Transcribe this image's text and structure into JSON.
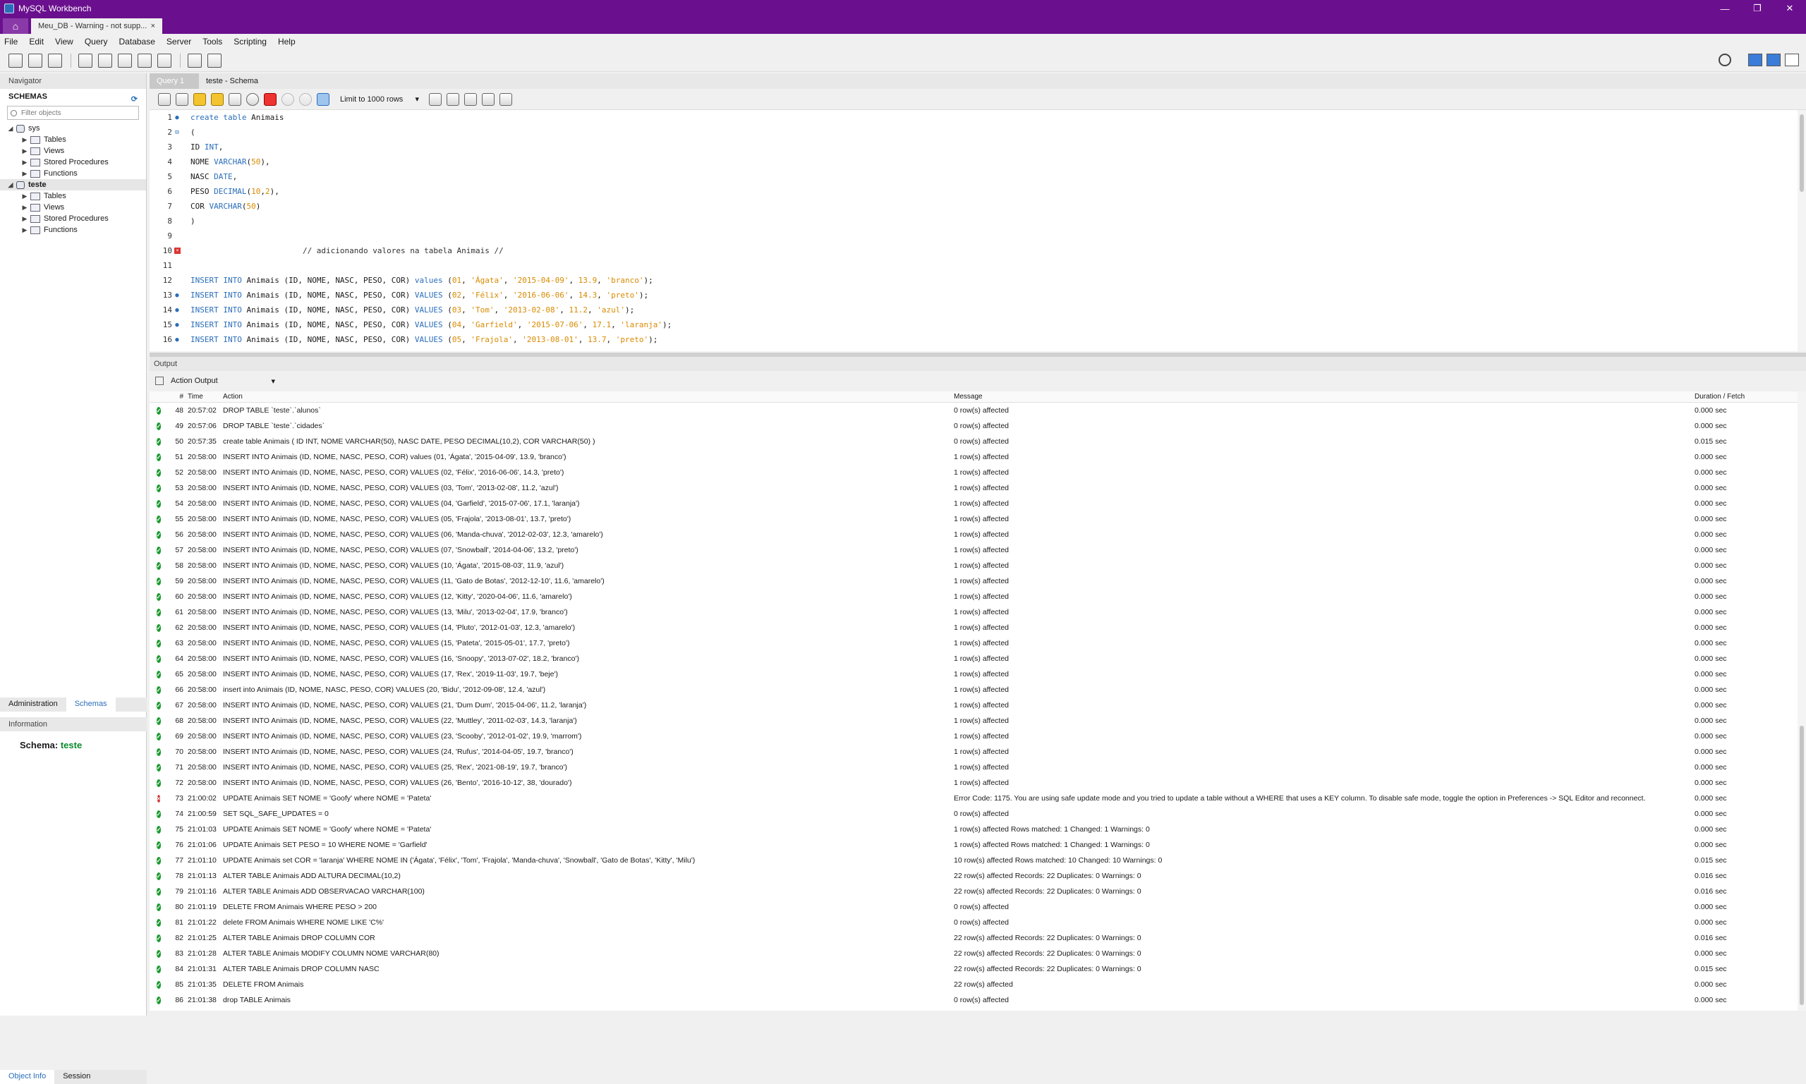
{
  "window": {
    "title": "MySQL Workbench",
    "controls": [
      "—",
      "❐",
      "✕"
    ]
  },
  "connection_tab": {
    "label": "Meu_DB - Warning - not supp...",
    "close": "×"
  },
  "menu": [
    "File",
    "Edit",
    "View",
    "Query",
    "Database",
    "Server",
    "Tools",
    "Scripting",
    "Help"
  ],
  "navigator": {
    "header": "Navigator",
    "schemas_label": "SCHEMAS",
    "filter_placeholder": "Filter objects",
    "tree": [
      {
        "label": "sys",
        "level": 0,
        "type": "db",
        "expanded": true
      },
      {
        "label": "Tables",
        "level": 1,
        "type": "folder"
      },
      {
        "label": "Views",
        "level": 1,
        "type": "folder"
      },
      {
        "label": "Stored Procedures",
        "level": 1,
        "type": "folder"
      },
      {
        "label": "Functions",
        "level": 1,
        "type": "folder"
      },
      {
        "label": "teste",
        "level": 0,
        "type": "db",
        "expanded": true,
        "selected": true
      },
      {
        "label": "Tables",
        "level": 1,
        "type": "folder"
      },
      {
        "label": "Views",
        "level": 1,
        "type": "folder"
      },
      {
        "label": "Stored Procedures",
        "level": 1,
        "type": "folder"
      },
      {
        "label": "Functions",
        "level": 1,
        "type": "folder"
      }
    ],
    "bottom_tabs": [
      "Administration",
      "Schemas"
    ],
    "info_header": "Information",
    "info_label": "Schema:",
    "info_value": "teste",
    "object_tabs": [
      "Object Info",
      "Session"
    ]
  },
  "editor": {
    "tabs": [
      "Query 1",
      "teste - Schema"
    ],
    "limit": "Limit to 1000 rows",
    "lines": [
      {
        "n": "1",
        "mark": "dot",
        "code": [
          [
            "create table ",
            "kw"
          ],
          [
            "Animais",
            ""
          ]
        ]
      },
      {
        "n": "2",
        "mark": "fold",
        "code": [
          [
            "(",
            ""
          ]
        ]
      },
      {
        "n": "3",
        "mark": "",
        "code": [
          [
            "ID ",
            ""
          ],
          [
            "INT",
            "kw"
          ],
          [
            ",",
            ""
          ]
        ]
      },
      {
        "n": "4",
        "mark": "",
        "code": [
          [
            "NOME ",
            ""
          ],
          [
            "VARCHAR",
            "kw"
          ],
          [
            "(",
            ""
          ],
          [
            "50",
            "num"
          ],
          [
            "),",
            ""
          ]
        ]
      },
      {
        "n": "5",
        "mark": "",
        "code": [
          [
            "NASC ",
            ""
          ],
          [
            "DATE",
            "kw"
          ],
          [
            ",",
            ""
          ]
        ]
      },
      {
        "n": "6",
        "mark": "",
        "code": [
          [
            "PESO ",
            ""
          ],
          [
            "DECIMAL",
            "kw"
          ],
          [
            "(",
            ""
          ],
          [
            "10",
            "num"
          ],
          [
            ",",
            ""
          ],
          [
            "2",
            "num"
          ],
          [
            "),",
            ""
          ]
        ]
      },
      {
        "n": "7",
        "mark": "",
        "code": [
          [
            "COR ",
            ""
          ],
          [
            "VARCHAR",
            "kw"
          ],
          [
            "(",
            ""
          ],
          [
            "50",
            "num"
          ],
          [
            ")",
            ""
          ]
        ]
      },
      {
        "n": "8",
        "mark": "",
        "code": [
          [
            ")",
            ""
          ]
        ]
      },
      {
        "n": "9",
        "mark": "",
        "code": [
          [
            "",
            ""
          ]
        ]
      },
      {
        "n": "10",
        "mark": "err",
        "code": [
          [
            "                        // adicionando valores na tabela Animais //",
            "cmt"
          ]
        ]
      },
      {
        "n": "11",
        "mark": "",
        "code": [
          [
            "",
            ""
          ]
        ]
      },
      {
        "n": "12",
        "mark": "",
        "code": [
          [
            "INSERT INTO ",
            "kw"
          ],
          [
            "Animais (ID, NOME, NASC, PESO, COR) ",
            ""
          ],
          [
            "values",
            "kw"
          ],
          [
            " (",
            ""
          ],
          [
            "01",
            "num"
          ],
          [
            ", ",
            ""
          ],
          [
            "'Ágata'",
            "str"
          ],
          [
            ", ",
            ""
          ],
          [
            "'2015-04-09'",
            "str"
          ],
          [
            ", ",
            ""
          ],
          [
            "13.9",
            "num"
          ],
          [
            ", ",
            ""
          ],
          [
            "'branco'",
            "str"
          ],
          [
            ");",
            ""
          ]
        ]
      },
      {
        "n": "13",
        "mark": "dot",
        "code": [
          [
            "INSERT INTO ",
            "kw"
          ],
          [
            "Animais (ID, NOME, NASC, PESO, COR) ",
            ""
          ],
          [
            "VALUES",
            "kw"
          ],
          [
            " (",
            ""
          ],
          [
            "02",
            "num"
          ],
          [
            ", ",
            ""
          ],
          [
            "'Félix'",
            "str"
          ],
          [
            ", ",
            ""
          ],
          [
            "'2016-06-06'",
            "str"
          ],
          [
            ", ",
            ""
          ],
          [
            "14.3",
            "num"
          ],
          [
            ", ",
            ""
          ],
          [
            "'preto'",
            "str"
          ],
          [
            ");",
            ""
          ]
        ]
      },
      {
        "n": "14",
        "mark": "dot",
        "code": [
          [
            "INSERT INTO ",
            "kw"
          ],
          [
            "Animais (ID, NOME, NASC, PESO, COR) ",
            ""
          ],
          [
            "VALUES",
            "kw"
          ],
          [
            " (",
            ""
          ],
          [
            "03",
            "num"
          ],
          [
            ", ",
            ""
          ],
          [
            "'Tom'",
            "str"
          ],
          [
            ", ",
            ""
          ],
          [
            "'2013-02-08'",
            "str"
          ],
          [
            ", ",
            ""
          ],
          [
            "11.2",
            "num"
          ],
          [
            ", ",
            ""
          ],
          [
            "'azul'",
            "str"
          ],
          [
            ");",
            ""
          ]
        ]
      },
      {
        "n": "15",
        "mark": "dot",
        "code": [
          [
            "INSERT INTO ",
            "kw"
          ],
          [
            "Animais (ID, NOME, NASC, PESO, COR) ",
            ""
          ],
          [
            "VALUES",
            "kw"
          ],
          [
            " (",
            ""
          ],
          [
            "04",
            "num"
          ],
          [
            ", ",
            ""
          ],
          [
            "'Garfield'",
            "str"
          ],
          [
            ", ",
            ""
          ],
          [
            "'2015-07-06'",
            "str"
          ],
          [
            ", ",
            ""
          ],
          [
            "17.1",
            "num"
          ],
          [
            ", ",
            ""
          ],
          [
            "'laranja'",
            "str"
          ],
          [
            ");",
            ""
          ]
        ]
      },
      {
        "n": "16",
        "mark": "dot",
        "code": [
          [
            "INSERT INTO ",
            "kw"
          ],
          [
            "Animais (ID, NOME, NASC, PESO, COR) ",
            ""
          ],
          [
            "VALUES",
            "kw"
          ],
          [
            " (",
            ""
          ],
          [
            "05",
            "num"
          ],
          [
            ", ",
            ""
          ],
          [
            "'Frajola'",
            "str"
          ],
          [
            ", ",
            ""
          ],
          [
            "'2013-08-01'",
            "str"
          ],
          [
            ", ",
            ""
          ],
          [
            "13.7",
            "num"
          ],
          [
            ", ",
            ""
          ],
          [
            "'preto'",
            "str"
          ],
          [
            ");",
            ""
          ]
        ]
      }
    ]
  },
  "output": {
    "header": "Output",
    "selector": "Action Output",
    "columns": [
      "#",
      "Time",
      "Action",
      "Message",
      "Duration / Fetch"
    ],
    "rows": [
      {
        "s": "ok",
        "n": "48",
        "t": "20:57:02",
        "a": "DROP TABLE `teste`.`alunos`",
        "m": "0 row(s) affected",
        "d": "0.000 sec"
      },
      {
        "s": "ok",
        "n": "49",
        "t": "20:57:06",
        "a": "DROP TABLE `teste`.`cidades`",
        "m": "0 row(s) affected",
        "d": "0.000 sec"
      },
      {
        "s": "ok",
        "n": "50",
        "t": "20:57:35",
        "a": "create table Animais ( ID INT, NOME VARCHAR(50), NASC DATE, PESO DECIMAL(10,2), COR VARCHAR(50) )",
        "m": "0 row(s) affected",
        "d": "0.015 sec"
      },
      {
        "s": "ok",
        "n": "51",
        "t": "20:58:00",
        "a": "INSERT INTO Animais (ID, NOME, NASC, PESO, COR) values (01, 'Ágata', '2015-04-09', 13.9, 'branco')",
        "m": "1 row(s) affected",
        "d": "0.000 sec"
      },
      {
        "s": "ok",
        "n": "52",
        "t": "20:58:00",
        "a": "INSERT INTO Animais (ID, NOME, NASC, PESO, COR) VALUES (02, 'Félix', '2016-06-06', 14.3, 'preto')",
        "m": "1 row(s) affected",
        "d": "0.000 sec"
      },
      {
        "s": "ok",
        "n": "53",
        "t": "20:58:00",
        "a": "INSERT INTO Animais (ID, NOME, NASC, PESO, COR) VALUES (03, 'Tom', '2013-02-08', 11.2, 'azul')",
        "m": "1 row(s) affected",
        "d": "0.000 sec"
      },
      {
        "s": "ok",
        "n": "54",
        "t": "20:58:00",
        "a": "INSERT INTO Animais (ID, NOME, NASC, PESO, COR) VALUES (04, 'Garfield', '2015-07-06', 17.1, 'laranja')",
        "m": "1 row(s) affected",
        "d": "0.000 sec"
      },
      {
        "s": "ok",
        "n": "55",
        "t": "20:58:00",
        "a": "INSERT INTO Animais (ID, NOME, NASC, PESO, COR) VALUES (05, 'Frajola', '2013-08-01', 13.7, 'preto')",
        "m": "1 row(s) affected",
        "d": "0.000 sec"
      },
      {
        "s": "ok",
        "n": "56",
        "t": "20:58:00",
        "a": "INSERT INTO Animais (ID, NOME, NASC, PESO, COR) VALUES (06, 'Manda-chuva', '2012-02-03', 12.3, 'amarelo')",
        "m": "1 row(s) affected",
        "d": "0.000 sec"
      },
      {
        "s": "ok",
        "n": "57",
        "t": "20:58:00",
        "a": "INSERT INTO Animais (ID, NOME, NASC, PESO, COR) VALUES (07, 'Snowball', '2014-04-06', 13.2, 'preto')",
        "m": "1 row(s) affected",
        "d": "0.000 sec"
      },
      {
        "s": "ok",
        "n": "58",
        "t": "20:58:00",
        "a": "INSERT INTO Animais (ID, NOME, NASC, PESO, COR) VALUES (10, 'Ágata', '2015-08-03', 11.9, 'azul')",
        "m": "1 row(s) affected",
        "d": "0.000 sec"
      },
      {
        "s": "ok",
        "n": "59",
        "t": "20:58:00",
        "a": "INSERT INTO Animais (ID, NOME, NASC, PESO, COR) VALUES (11, 'Gato de Botas', '2012-12-10', 11.6, 'amarelo')",
        "m": "1 row(s) affected",
        "d": "0.000 sec"
      },
      {
        "s": "ok",
        "n": "60",
        "t": "20:58:00",
        "a": "INSERT INTO Animais (ID, NOME, NASC, PESO, COR) VALUES (12, 'Kitty', '2020-04-06', 11.6, 'amarelo')",
        "m": "1 row(s) affected",
        "d": "0.000 sec"
      },
      {
        "s": "ok",
        "n": "61",
        "t": "20:58:00",
        "a": "INSERT INTO Animais (ID, NOME, NASC, PESO, COR) VALUES (13, 'Milu', '2013-02-04', 17.9, 'branco')",
        "m": "1 row(s) affected",
        "d": "0.000 sec"
      },
      {
        "s": "ok",
        "n": "62",
        "t": "20:58:00",
        "a": "INSERT INTO Animais (ID, NOME, NASC, PESO, COR) VALUES (14, 'Pluto', '2012-01-03', 12.3, 'amarelo')",
        "m": "1 row(s) affected",
        "d": "0.000 sec"
      },
      {
        "s": "ok",
        "n": "63",
        "t": "20:58:00",
        "a": "INSERT INTO Animais (ID, NOME, NASC, PESO, COR) VALUES (15, 'Pateta', '2015-05-01', 17.7, 'preto')",
        "m": "1 row(s) affected",
        "d": "0.000 sec"
      },
      {
        "s": "ok",
        "n": "64",
        "t": "20:58:00",
        "a": "INSERT INTO Animais (ID, NOME, NASC, PESO, COR) VALUES (16, 'Snoopy', '2013-07-02', 18.2, 'branco')",
        "m": "1 row(s) affected",
        "d": "0.000 sec"
      },
      {
        "s": "ok",
        "n": "65",
        "t": "20:58:00",
        "a": "INSERT INTO Animais (ID, NOME, NASC, PESO, COR) VALUES (17, 'Rex', '2019-11-03', 19.7, 'beje')",
        "m": "1 row(s) affected",
        "d": "0.000 sec"
      },
      {
        "s": "ok",
        "n": "66",
        "t": "20:58:00",
        "a": "insert into Animais (ID, NOME, NASC, PESO, COR) VALUES (20, 'Bidu', '2012-09-08', 12.4, 'azul')",
        "m": "1 row(s) affected",
        "d": "0.000 sec"
      },
      {
        "s": "ok",
        "n": "67",
        "t": "20:58:00",
        "a": "INSERT INTO Animais (ID, NOME, NASC, PESO, COR) VALUES (21, 'Dum Dum', '2015-04-06', 11.2, 'laranja')",
        "m": "1 row(s) affected",
        "d": "0.000 sec"
      },
      {
        "s": "ok",
        "n": "68",
        "t": "20:58:00",
        "a": "INSERT INTO Animais (ID, NOME, NASC, PESO, COR) VALUES (22, 'Muttley', '2011-02-03', 14.3, 'laranja')",
        "m": "1 row(s) affected",
        "d": "0.000 sec"
      },
      {
        "s": "ok",
        "n": "69",
        "t": "20:58:00",
        "a": "INSERT INTO Animais (ID, NOME, NASC, PESO, COR) VALUES (23, 'Scooby', '2012-01-02', 19.9, 'marrom')",
        "m": "1 row(s) affected",
        "d": "0.000 sec"
      },
      {
        "s": "ok",
        "n": "70",
        "t": "20:58:00",
        "a": "INSERT INTO Animais (ID, NOME, NASC, PESO, COR) VALUES (24, 'Rufus', '2014-04-05', 19.7, 'branco')",
        "m": "1 row(s) affected",
        "d": "0.000 sec"
      },
      {
        "s": "ok",
        "n": "71",
        "t": "20:58:00",
        "a": "INSERT INTO Animais (ID, NOME, NASC, PESO, COR) VALUES (25, 'Rex', '2021-08-19', 19.7, 'branco')",
        "m": "1 row(s) affected",
        "d": "0.000 sec"
      },
      {
        "s": "ok",
        "n": "72",
        "t": "20:58:00",
        "a": "INSERT INTO Animais (ID, NOME, NASC, PESO, COR) VALUES (26, 'Bento', '2016-10-12', 38, 'dourado')",
        "m": "1 row(s) affected",
        "d": "0.000 sec"
      },
      {
        "s": "err",
        "n": "73",
        "t": "21:00:02",
        "a": "UPDATE Animais SET NOME = 'Goofy' where NOME = 'Pateta'",
        "m": "Error Code: 1175. You are using safe update mode and you tried to update a table without a WHERE that uses a KEY column.  To disable safe mode, toggle the option in Preferences -> SQL Editor and reconnect.",
        "d": "0.000 sec"
      },
      {
        "s": "ok",
        "n": "74",
        "t": "21:00:59",
        "a": "SET SQL_SAFE_UPDATES = 0",
        "m": "0 row(s) affected",
        "d": "0.000 sec"
      },
      {
        "s": "ok",
        "n": "75",
        "t": "21:01:03",
        "a": "UPDATE Animais SET NOME = 'Goofy' where NOME = 'Pateta'",
        "m": "1 row(s) affected Rows matched: 1  Changed: 1  Warnings: 0",
        "d": "0.000 sec"
      },
      {
        "s": "ok",
        "n": "76",
        "t": "21:01:06",
        "a": "UPDATE Animais SET PESO = 10 WHERE NOME = 'Garfield'",
        "m": "1 row(s) affected Rows matched: 1  Changed: 1  Warnings: 0",
        "d": "0.000 sec"
      },
      {
        "s": "ok",
        "n": "77",
        "t": "21:01:10",
        "a": "UPDATE Animais set COR = 'laranja' WHERE NOME IN ('Ágata', 'Félix', 'Tom', 'Frajola', 'Manda-chuva', 'Snowball', 'Gato de Botas', 'Kitty', 'Milu')",
        "m": "10 row(s) affected Rows matched: 10  Changed: 10  Warnings: 0",
        "d": "0.015 sec"
      },
      {
        "s": "ok",
        "n": "78",
        "t": "21:01:13",
        "a": "ALTER TABLE Animais ADD ALTURA DECIMAL(10,2)",
        "m": "22 row(s) affected Records: 22  Duplicates: 0  Warnings: 0",
        "d": "0.016 sec"
      },
      {
        "s": "ok",
        "n": "79",
        "t": "21:01:16",
        "a": "ALTER TABLE Animais ADD OBSERVACAO VARCHAR(100)",
        "m": "22 row(s) affected Records: 22  Duplicates: 0  Warnings: 0",
        "d": "0.016 sec"
      },
      {
        "s": "ok",
        "n": "80",
        "t": "21:01:19",
        "a": "DELETE FROM Animais WHERE PESO > 200",
        "m": "0 row(s) affected",
        "d": "0.000 sec"
      },
      {
        "s": "ok",
        "n": "81",
        "t": "21:01:22",
        "a": "delete FROM Animais WHERE NOME LIKE 'C%'",
        "m": "0 row(s) affected",
        "d": "0.000 sec"
      },
      {
        "s": "ok",
        "n": "82",
        "t": "21:01:25",
        "a": "ALTER TABLE Animais DROP COLUMN COR",
        "m": "22 row(s) affected Records: 22  Duplicates: 0  Warnings: 0",
        "d": "0.016 sec"
      },
      {
        "s": "ok",
        "n": "83",
        "t": "21:01:28",
        "a": "ALTER TABLE Animais MODIFY COLUMN NOME VARCHAR(80)",
        "m": "22 row(s) affected Records: 22  Duplicates: 0  Warnings: 0",
        "d": "0.000 sec"
      },
      {
        "s": "ok",
        "n": "84",
        "t": "21:01:31",
        "a": "ALTER TABLE Animais DROP COLUMN NASC",
        "m": "22 row(s) affected Records: 22  Duplicates: 0  Warnings: 0",
        "d": "0.015 sec"
      },
      {
        "s": "ok",
        "n": "85",
        "t": "21:01:35",
        "a": "DELETE FROM Animais",
        "m": "22 row(s) affected",
        "d": "0.000 sec"
      },
      {
        "s": "ok",
        "n": "86",
        "t": "21:01:38",
        "a": "drop TABLE Animais",
        "m": "0 row(s) affected",
        "d": "0.000 sec"
      }
    ]
  },
  "colors": {
    "titlebar": "#6a0f8e",
    "keyword": "#2a6ebb",
    "string": "#d98a00",
    "ok": "#1a9a2e",
    "error": "#d32f2f",
    "schema_value": "#0a8a2a"
  }
}
